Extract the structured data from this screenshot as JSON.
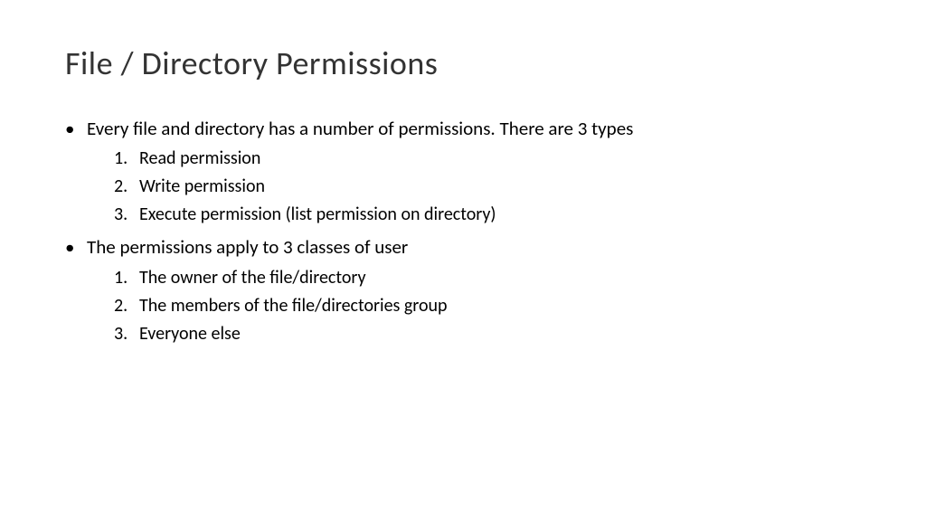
{
  "slide": {
    "title": "File / Directory Permissions",
    "bullets": [
      {
        "text": "Every file and directory has a number of permissions.  There are 3 types",
        "items": [
          "Read permission",
          "Write permission",
          "Execute permission (list permission on directory)"
        ]
      },
      {
        "text": "The permissions apply to 3 classes of user",
        "items": [
          "The owner of the file/directory",
          "The members of the file/directories group",
          "Everyone else"
        ]
      }
    ]
  }
}
